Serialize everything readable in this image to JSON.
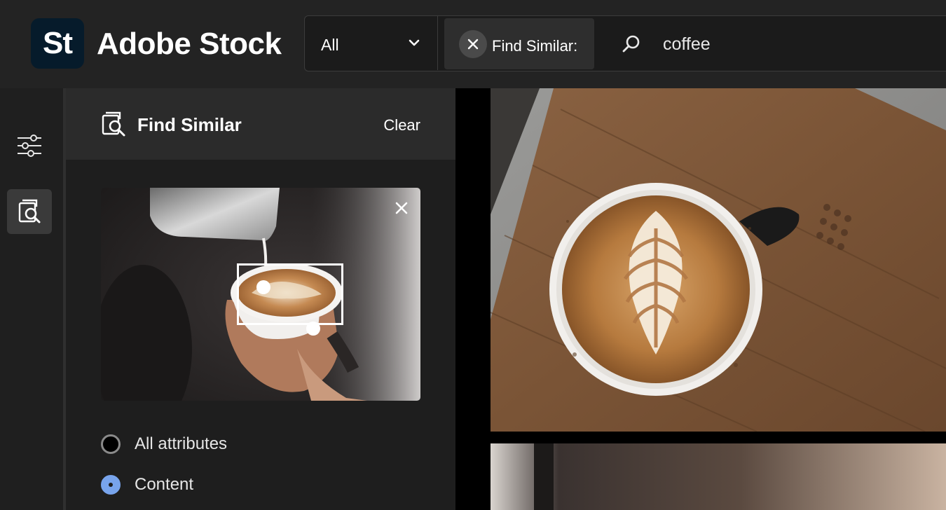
{
  "brand": {
    "logo_text": "St",
    "name": "Adobe Stock"
  },
  "search": {
    "type_selected": "All",
    "chip_label": "Find Similar:",
    "query": "coffee"
  },
  "rail": {
    "items": [
      {
        "icon": "filters-icon",
        "active": false
      },
      {
        "icon": "find-similar-icon",
        "active": true
      }
    ]
  },
  "panel": {
    "title": "Find Similar",
    "clear_label": "Clear",
    "options": [
      {
        "label": "All attributes",
        "selected": false
      },
      {
        "label": "Content",
        "selected": true
      }
    ]
  },
  "colors": {
    "accent": "#78a4ec",
    "header_bg": "#232323",
    "panel_bg": "#1e1e1e"
  }
}
